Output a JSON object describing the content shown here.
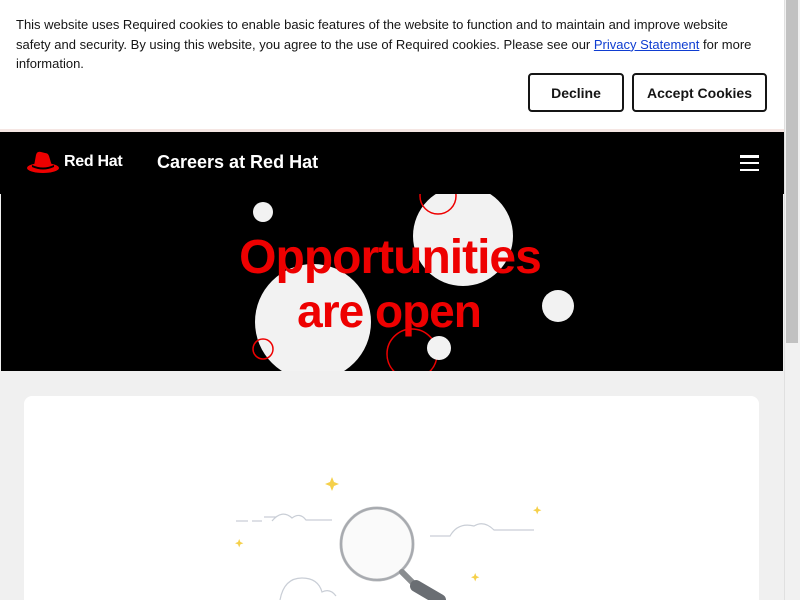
{
  "cookie_banner": {
    "text_before_link": "This website uses Required cookies to enable basic features of the website to function and to maintain and improve website safety and security. By using this website, you agree to the use of Required cookies. Please see our ",
    "link_text": "Privacy Statement",
    "text_after_link": " for more information.",
    "decline_label": "Decline",
    "accept_label": "Accept Cookies"
  },
  "header": {
    "logo_text": "Red Hat",
    "title": "Careers at Red Hat",
    "menu_icon": "hamburger-menu-icon"
  },
  "hero": {
    "line1": "Opportunities",
    "line2": "are open"
  },
  "illustration": {
    "icon": "magnifying-glass-icon"
  },
  "colors": {
    "brand_red": "#ee0000",
    "header_bg": "#000000",
    "link_blue": "#0f3dd1"
  }
}
